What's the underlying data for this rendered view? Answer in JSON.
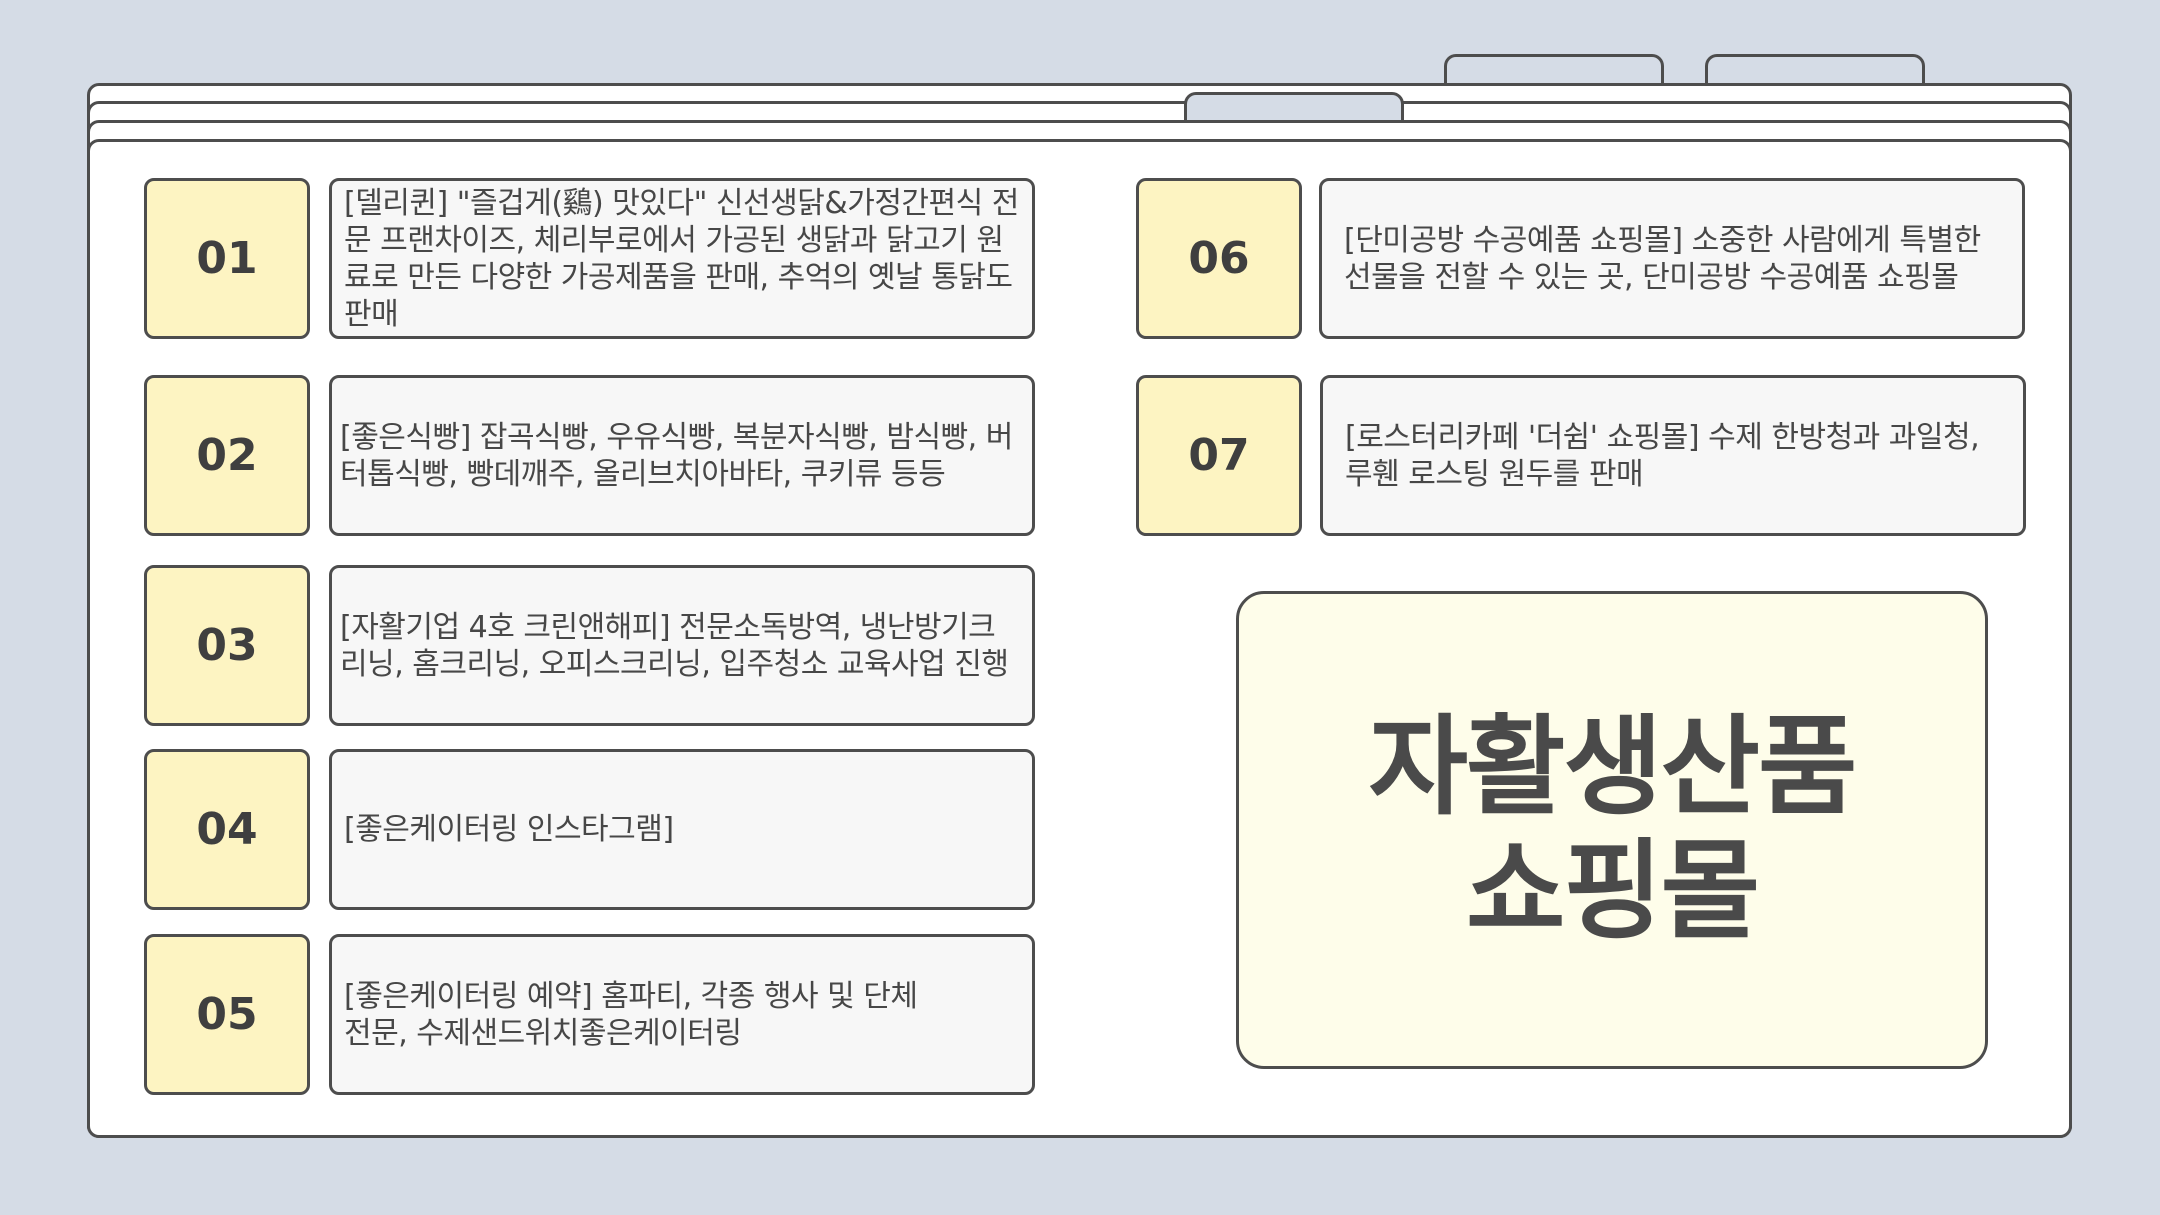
{
  "items": [
    {
      "number": "01",
      "text": "[델리퀸] \"즐겁게(鷄) 맛있다\" 신선생닭&가정간편식 전문 프랜차이즈, 체리부로에서 가공된 생닭과 닭고기 원료로 만든 다양한 가공제품을 판매, 추억의 옛날 통닭도 판매"
    },
    {
      "number": "02",
      "text": "[좋은식빵] 잡곡식빵, 우유식빵, 복분자식빵, 밤식빵, 버터톱식빵, 빵데깨주, 올리브치아바타, 쿠키류 등등"
    },
    {
      "number": "03",
      "text": "[자활기업 4호 크린앤해피] 전문소독방역, 냉난방기크리닝, 홈크리닝, 오피스크리닝, 입주청소 교육사업 진행"
    },
    {
      "number": "04",
      "text": "[좋은케이터링 인스타그램]"
    },
    {
      "number": "05",
      "text": "[좋은케이터링 예약] 홈파티, 각종 행사 및 단체 전문, 수제샌드위치좋은케이터링"
    },
    {
      "number": "06",
      "text": "[단미공방 수공예품 쇼핑몰] 소중한 사람에게 특별한 선물을 전할 수 있는 곳, 단미공방 수공예품 쇼핑몰"
    },
    {
      "number": "07",
      "text": "[로스터리카페 '더쉼' 쇼핑몰] 수제 한방청과 과일청, 루휀 로스팅 원두를 판매"
    }
  ],
  "title": {
    "line1": "자활생산품",
    "line2": "쇼핑몰"
  }
}
